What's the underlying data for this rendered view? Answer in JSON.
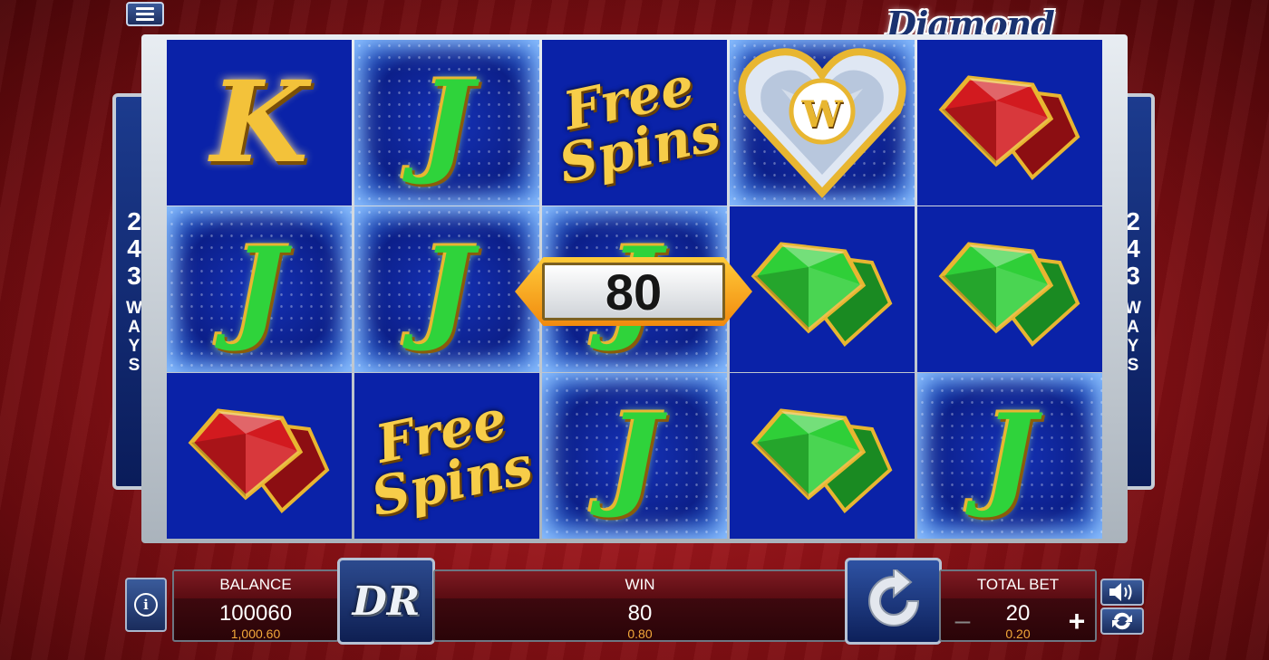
{
  "game": {
    "title": "Diamond Rain"
  },
  "ways": {
    "number_digits": [
      "2",
      "4",
      "3"
    ],
    "word_letters": [
      "W",
      "A",
      "Y",
      "S"
    ]
  },
  "reels": [
    [
      {
        "symbol": "K",
        "type": "letter-k",
        "bg": "dark"
      },
      {
        "symbol": "J",
        "type": "letter-j",
        "bg": "light"
      },
      {
        "symbol": "red-gem",
        "type": "gem",
        "bg": "dark"
      }
    ],
    [
      {
        "symbol": "J",
        "type": "letter-j",
        "bg": "light"
      },
      {
        "symbol": "J",
        "type": "letter-j",
        "bg": "light"
      },
      {
        "symbol": "free-spins",
        "type": "freespins",
        "bg": "dark"
      }
    ],
    [
      {
        "symbol": "free-spins",
        "type": "freespins",
        "bg": "dark"
      },
      {
        "symbol": "J",
        "type": "letter-j",
        "bg": "light"
      },
      {
        "symbol": "J",
        "type": "letter-j",
        "bg": "light"
      }
    ],
    [
      {
        "symbol": "wild",
        "type": "wild",
        "bg": "light"
      },
      {
        "symbol": "green-gem",
        "type": "gem",
        "bg": "dark"
      },
      {
        "symbol": "green-gem",
        "type": "gem",
        "bg": "dark"
      }
    ],
    [
      {
        "symbol": "red-gem",
        "type": "gem",
        "bg": "dark"
      },
      {
        "symbol": "green-gem",
        "type": "gem",
        "bg": "dark"
      },
      {
        "symbol": "J",
        "type": "letter-j",
        "bg": "light"
      }
    ]
  ],
  "symbols": {
    "free_spins_line1": "Free",
    "free_spins_line2": "Spins",
    "wild_letter": "W",
    "logo_letters": "DR"
  },
  "win_banner": {
    "value": "80"
  },
  "balance": {
    "label": "BALANCE",
    "credits": "100060",
    "money": "1,000.60"
  },
  "win": {
    "label": "WIN",
    "credits": "80",
    "money": "0.80"
  },
  "total_bet": {
    "label": "TOTAL BET",
    "credits": "20",
    "money": "0.20",
    "minus": "–",
    "plus": "+"
  },
  "colors": {
    "red_gem": "#d21a1f",
    "green_gem": "#2fcf38",
    "gold": "#f3c23a",
    "reel_blue": "#0a22a8"
  }
}
